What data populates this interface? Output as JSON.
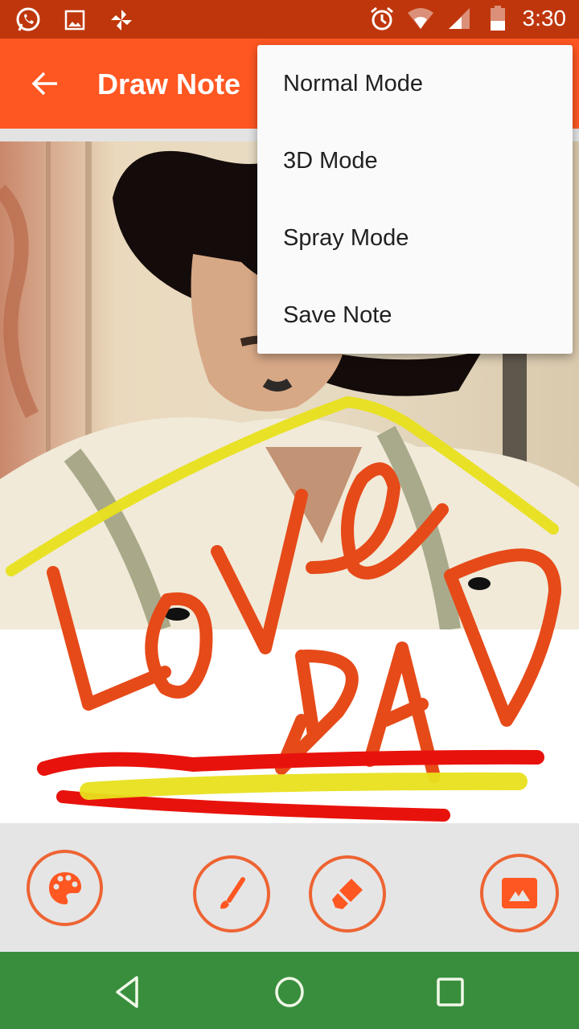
{
  "status_bar": {
    "time": "3:30",
    "left_icons": [
      "whatsapp-icon",
      "image-icon",
      "pinwheel-icon"
    ],
    "right_icons": [
      "alarm-icon",
      "wifi-icon",
      "signal-icon",
      "battery-icon"
    ]
  },
  "app_bar": {
    "title": "Draw Note",
    "back_icon": "arrow-left-icon"
  },
  "menu": {
    "items": [
      {
        "label": "Normal Mode"
      },
      {
        "label": "3D Mode"
      },
      {
        "label": "Spray Mode"
      },
      {
        "label": "Save Note"
      }
    ]
  },
  "canvas": {
    "handwritten_text": [
      "LOVE",
      "DAD"
    ],
    "stroke_colors": {
      "text": "#e64a19",
      "highlight": "#e8e01c",
      "underline": "#e8120c"
    }
  },
  "toolbar": {
    "buttons": [
      {
        "name": "palette",
        "icon": "palette-icon"
      },
      {
        "name": "brush",
        "icon": "brush-icon"
      },
      {
        "name": "eraser",
        "icon": "eraser-icon"
      },
      {
        "name": "image",
        "icon": "image-icon"
      }
    ]
  },
  "nav_bar": {
    "buttons": [
      "back-triangle-icon",
      "home-circle-icon",
      "recents-square-icon"
    ]
  },
  "colors": {
    "status_bar": "#bf360c",
    "app_bar": "#ff5722",
    "accent": "#ee6433",
    "nav_bar": "#388e3c",
    "menu_bg": "#fafafa"
  }
}
